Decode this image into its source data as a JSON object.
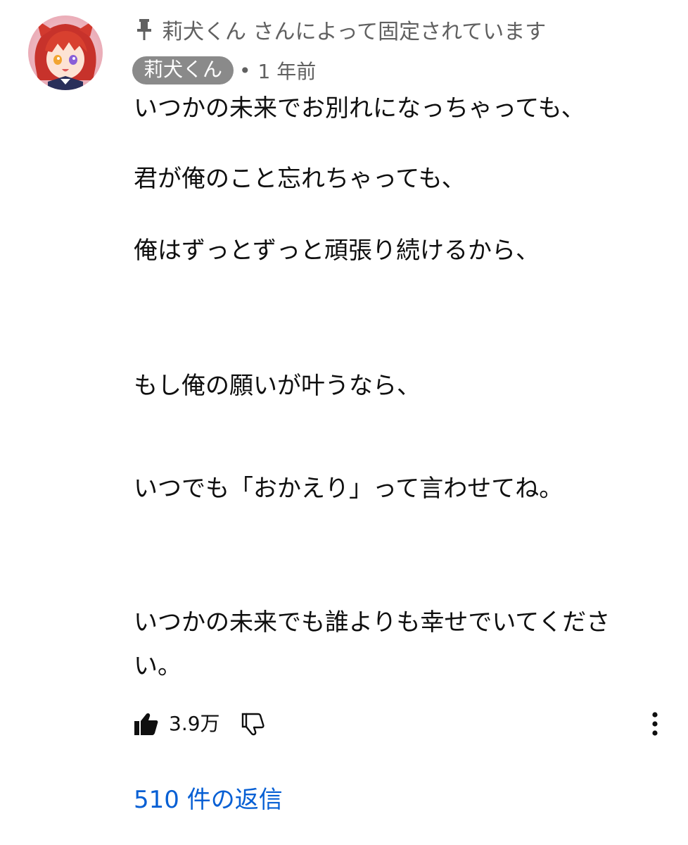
{
  "pinned": {
    "icon": "pin-icon",
    "text": "莉犬くん さんによって固定されています"
  },
  "author": {
    "name": "莉犬くん",
    "separator": "•",
    "time": "1 年前",
    "avatar_icon": "avatar-illustration"
  },
  "comment": {
    "lines": [
      "いつかの未来でお別れになっちゃっても、",
      "君が俺のこと忘れちゃっても、",
      "俺はずっとずっと頑張り続けるから、",
      "もし俺の願いが叶うなら、",
      "いつでも「おかえり」って言わせてね。",
      "いつかの未来でも誰よりも幸せでいてくださ",
      "い。"
    ]
  },
  "actions": {
    "like_icon": "thumbs-up-icon",
    "like_count": "3.9万",
    "dislike_icon": "thumbs-down-icon",
    "more_icon": "more-vert-icon"
  },
  "replies": {
    "label": "510 件の返信"
  },
  "colors": {
    "text": "#0f0f0f",
    "secondary": "#606060",
    "badge_bg": "#8a8a8a",
    "link": "#065fd4"
  }
}
